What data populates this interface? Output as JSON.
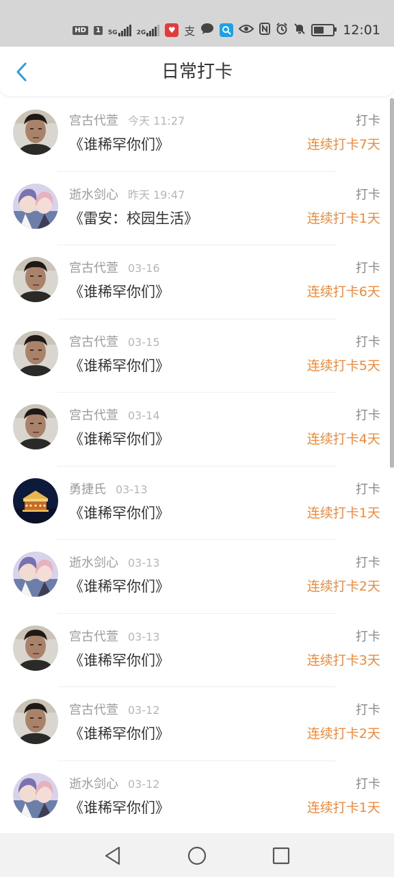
{
  "status_bar": {
    "time": "12:01",
    "hd_label": "HD",
    "sim1_label": "1",
    "net1_label": "5G",
    "net2_label": "2G",
    "pay_glyph": "支",
    "icons": [
      "hd-icon",
      "signal-5g-icon",
      "signal-2g-icon",
      "app-icon",
      "alipay-icon",
      "chat-icon",
      "search-app-icon",
      "eye-icon",
      "nfc-icon",
      "alarm-icon",
      "mute-icon",
      "battery-icon"
    ]
  },
  "header": {
    "title": "日常打卡",
    "back_icon": "chevron-left-icon",
    "accent_color": "#2b9be6"
  },
  "checkins": [
    {
      "user": "宫古代萱",
      "time": "今天 11:27",
      "book": "《谁稀罕你们》",
      "action": "打卡",
      "streak": "连续打卡7天",
      "avatar": "portrait"
    },
    {
      "user": "逝水剑心",
      "time": "昨天 19:47",
      "book": "《雷安：校园生活》",
      "action": "打卡",
      "streak": "连续打卡1天",
      "avatar": "anime"
    },
    {
      "user": "宫古代萱",
      "time": "03-16",
      "book": "《谁稀罕你们》",
      "action": "打卡",
      "streak": "连续打卡6天",
      "avatar": "portrait"
    },
    {
      "user": "宫古代萱",
      "time": "03-15",
      "book": "《谁稀罕你们》",
      "action": "打卡",
      "streak": "连续打卡5天",
      "avatar": "portrait"
    },
    {
      "user": "宫古代萱",
      "time": "03-14",
      "book": "《谁稀罕你们》",
      "action": "打卡",
      "streak": "连续打卡4天",
      "avatar": "portrait"
    },
    {
      "user": "勇捷氏",
      "time": "03-13",
      "book": "《谁稀罕你们》",
      "action": "打卡",
      "streak": "连续打卡1天",
      "avatar": "carousel"
    },
    {
      "user": "逝水剑心",
      "time": "03-13",
      "book": "《谁稀罕你们》",
      "action": "打卡",
      "streak": "连续打卡2天",
      "avatar": "anime"
    },
    {
      "user": "宫古代萱",
      "time": "03-13",
      "book": "《谁稀罕你们》",
      "action": "打卡",
      "streak": "连续打卡3天",
      "avatar": "portrait"
    },
    {
      "user": "宫古代萱",
      "time": "03-12",
      "book": "《谁稀罕你们》",
      "action": "打卡",
      "streak": "连续打卡2天",
      "avatar": "portrait"
    },
    {
      "user": "逝水剑心",
      "time": "03-12",
      "book": "《谁稀罕你们》",
      "action": "打卡",
      "streak": "连续打卡1天",
      "avatar": "anime"
    }
  ],
  "colors": {
    "streak": "#f08a3a",
    "status_bar_bg": "#d6d6d6",
    "nav_bar_bg": "#f2f2f2"
  },
  "nav_bar": {
    "icons": [
      "back-triangle-icon",
      "home-circle-icon",
      "recents-square-icon"
    ]
  }
}
